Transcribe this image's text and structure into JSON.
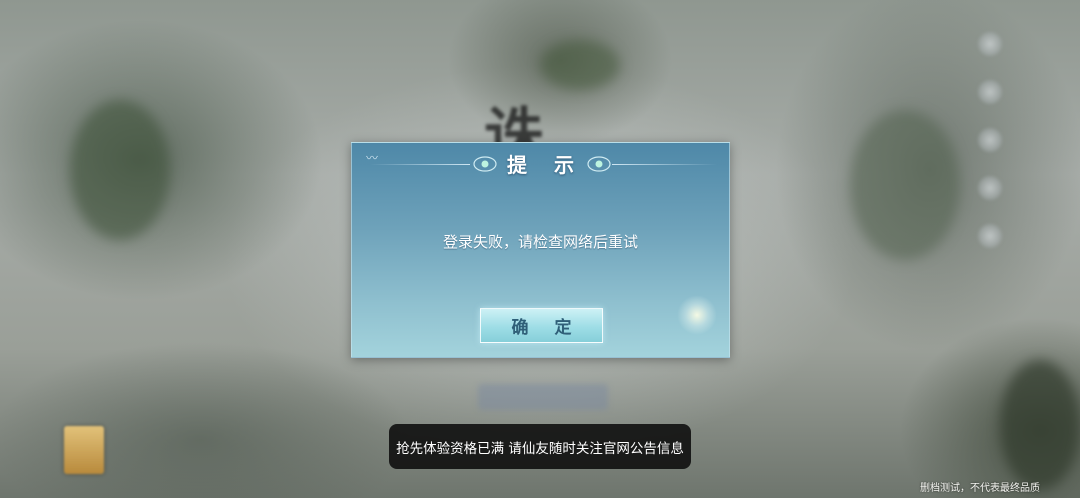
{
  "background": {
    "logo_text": "诛",
    "side_icons": [
      "decor-icon",
      "decor-icon",
      "decor-icon",
      "decor-icon",
      "decor-icon"
    ]
  },
  "dialog": {
    "title": "提 示",
    "message": "登录失败，请检查网络后重试",
    "confirm_label": "确 定",
    "accent_color": "#4e88a8"
  },
  "toast": {
    "message": "抢先体验资格已满 请仙友随时关注官网公告信息"
  },
  "footer": {
    "disclaimer": "删档测试，不代表最终品质"
  }
}
